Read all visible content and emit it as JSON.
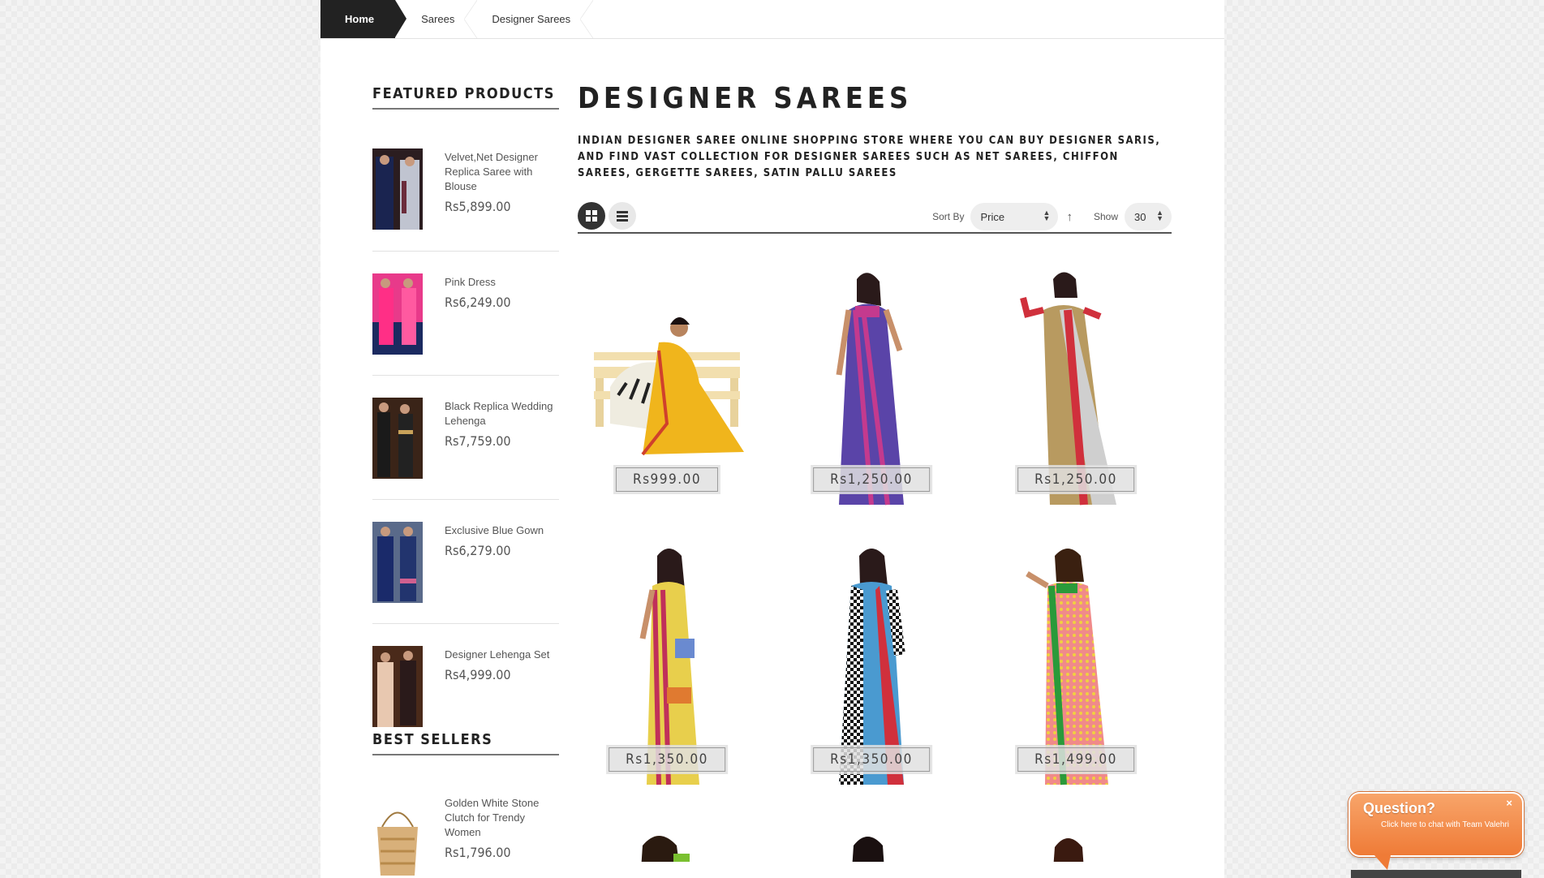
{
  "breadcrumb": {
    "items": [
      "Home",
      "Sarees",
      "Designer Sarees"
    ]
  },
  "sidebar": {
    "featured_title": "FEATURED PRODUCTS",
    "featured": [
      {
        "name": "Velvet,Net Designer Replica Saree with Blouse",
        "price": "Rs5,899.00"
      },
      {
        "name": "Pink Dress",
        "price": "Rs6,249.00"
      },
      {
        "name": "Black Replica Wedding Lehenga",
        "price": "Rs7,759.00"
      },
      {
        "name": "Exclusive Blue Gown",
        "price": "Rs6,279.00"
      },
      {
        "name": "Designer Lehenga Set",
        "price": "Rs4,999.00"
      }
    ],
    "bestsellers_title": "BEST SELLERS",
    "bestsellers": [
      {
        "name": "Golden White Stone Clutch for Trendy Women",
        "price": "Rs1,796.00"
      }
    ]
  },
  "main": {
    "title": "DESIGNER SAREES",
    "description": "INDIAN DESIGNER SAREE ONLINE SHOPPING STORE WHERE YOU CAN BUY DESIGNER SARIS, AND FIND VAST COLLECTION FOR DESIGNER SAREES SUCH AS NET SAREES, CHIFFON SAREES, GERGETTE SAREES, SATIN PALLU SAREES",
    "toolbar": {
      "sort_label": "Sort By",
      "sort_value": "Price",
      "show_label": "Show",
      "show_value": "30"
    },
    "products": [
      {
        "price": "Rs999.00"
      },
      {
        "price": "Rs1,250.00"
      },
      {
        "price": "Rs1,250.00"
      },
      {
        "price": "Rs1,350.00"
      },
      {
        "price": "Rs1,350.00"
      },
      {
        "price": "Rs1,499.00"
      }
    ]
  },
  "chat": {
    "title": "Question?",
    "subtitle": "Click here to chat with Team Valehri",
    "close": "×"
  }
}
